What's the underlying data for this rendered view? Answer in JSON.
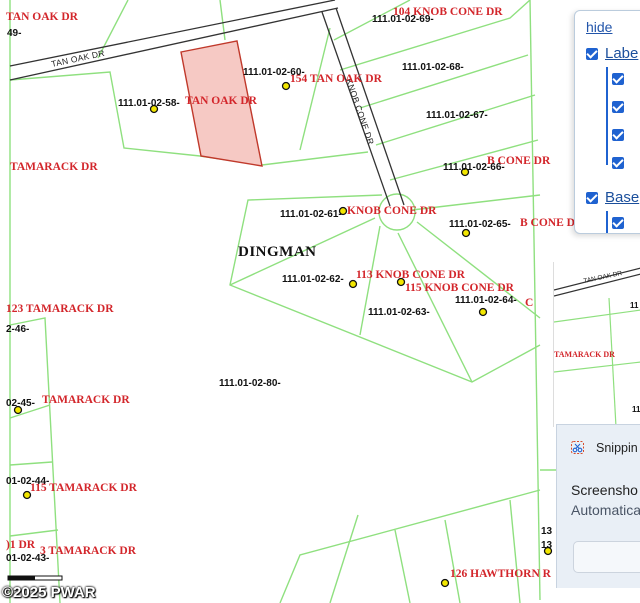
{
  "map": {
    "township": "DINGMAN",
    "roads": {
      "tan_oak": "TAN OAK DR",
      "knob_cone": "KNOB CONE DR",
      "mini_tan_oak": "TAN OAK DR"
    },
    "parcel_ids": [
      "111.01-02-69-",
      "111.01-02-68-",
      "111.01-02-67-",
      "111.01-02-66-",
      "111.01-02-65-",
      "111.01-02-64-",
      "111.01-02-63-",
      "111.01-02-62-",
      "111.01-02-61-",
      "111.01-02-60-",
      "111.01-02-58-",
      "111.01-02-80-",
      "49-",
      "2-46-",
      "02-45-",
      "01-02-44-",
      "01-02-43-",
      "1-02-",
      "9-",
      "11",
      "11",
      "13",
      "13"
    ],
    "addresses": [
      "TAN OAK DR",
      "104 KNOB CONE DR",
      "154 TAN OAK DR",
      "TAN OAK DR",
      "KNOB CONE DR",
      "B CONE DR",
      "KNOB CONE DR",
      "113 KNOB CONE DR",
      "115 KNOB CONE DR",
      "C",
      "TAMARACK DR",
      "123 TAMARACK DR",
      "TAMARACK DR",
      "115 TAMARACK DR",
      ")1 DR",
      "3 TAMARACK DR",
      "126 HAWTHORN R",
      "TAMARACK DR",
      "B CONE DR"
    ]
  },
  "layer_panel": {
    "hide_label": "hide",
    "labels_label": "Labe",
    "base_label": "Base"
  },
  "snipping": {
    "app_name": "Snippin",
    "title": "Screensho",
    "subtitle": "Automatica"
  },
  "watermark": "©2025 PWAR"
}
